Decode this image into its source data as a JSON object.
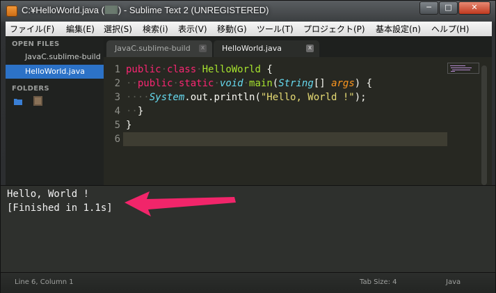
{
  "window": {
    "title_prefix": "C:¥HelloWorld.java (",
    "title_suffix": ") - Sublime Text 2 (UNREGISTERED)",
    "controls": {
      "minimize": "─",
      "maximize": "□",
      "close": "✕"
    }
  },
  "menu": {
    "items": [
      "ファイル(F)",
      "編集(E)",
      "選択(S)",
      "検索(i)",
      "表示(V)",
      "移動(G)",
      "ツール(T)",
      "プロジェクト(P)",
      "基本設定(n)",
      "ヘルプ(H)"
    ]
  },
  "sidebar": {
    "open_files_header": "OPEN FILES",
    "files": [
      "JavaC.sublime-build",
      "HelloWorld.java"
    ],
    "folders_header": "FOLDERS"
  },
  "tabs": [
    {
      "label": "JavaC.sublime-build",
      "close": "x"
    },
    {
      "label": "HelloWorld.java",
      "close": "x"
    }
  ],
  "editor": {
    "line_numbers": [
      "1",
      "2",
      "3",
      "4",
      "5",
      "6"
    ],
    "tokens": {
      "kw_public": "public",
      "kw_class": "class",
      "class_name": "HelloWorld",
      "brace_open": " {",
      "kw_static": "static",
      "kw_void": "void",
      "method_main": "main",
      "type_string": "String",
      "brackets": "[] ",
      "arg_args": "args",
      "paren_close_brace": ") {",
      "system": "System",
      "dot_out_println": ".out.println(",
      "hello_string": "\"Hello, World !\"",
      "stmt_end": ");",
      "brace_close": "}",
      "paren_open": "("
    }
  },
  "output": {
    "lines": [
      "Hello, World !",
      "[Finished in 1.1s]"
    ]
  },
  "status": {
    "position": "Line 6, Column 1",
    "tab_size": "Tab Size: 4",
    "syntax": "Java"
  },
  "colors": {
    "accent_arrow": "#f1256a",
    "selection": "#2c72c7"
  }
}
